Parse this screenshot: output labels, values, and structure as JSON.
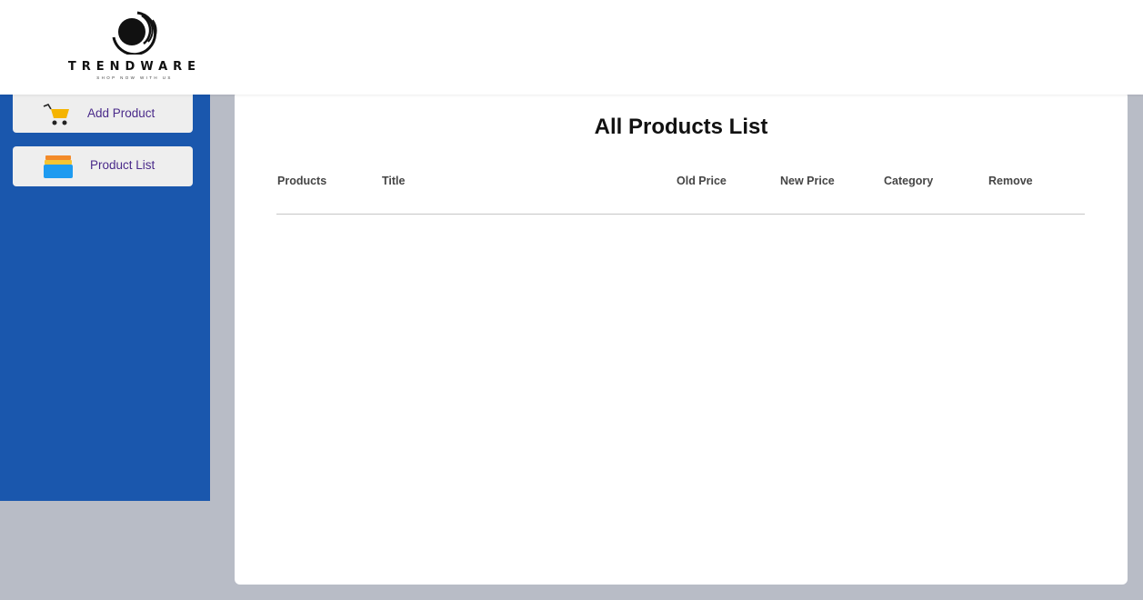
{
  "brand": {
    "name": "TRENDWARE",
    "tagline": "SHOP NOW WITH US",
    "logo_icon": "concentric-orbit-logo"
  },
  "sidebar": {
    "background": "#1a57ad",
    "items": [
      {
        "label": "Add Product",
        "icon": "shopping-cart-icon"
      },
      {
        "label": "Product List",
        "icon": "stacked-list-icon"
      }
    ]
  },
  "main": {
    "title": "All Products List",
    "columns": [
      "Products",
      "Title",
      "Old Price",
      "New Price",
      "Category",
      "Remove"
    ],
    "rows": []
  }
}
